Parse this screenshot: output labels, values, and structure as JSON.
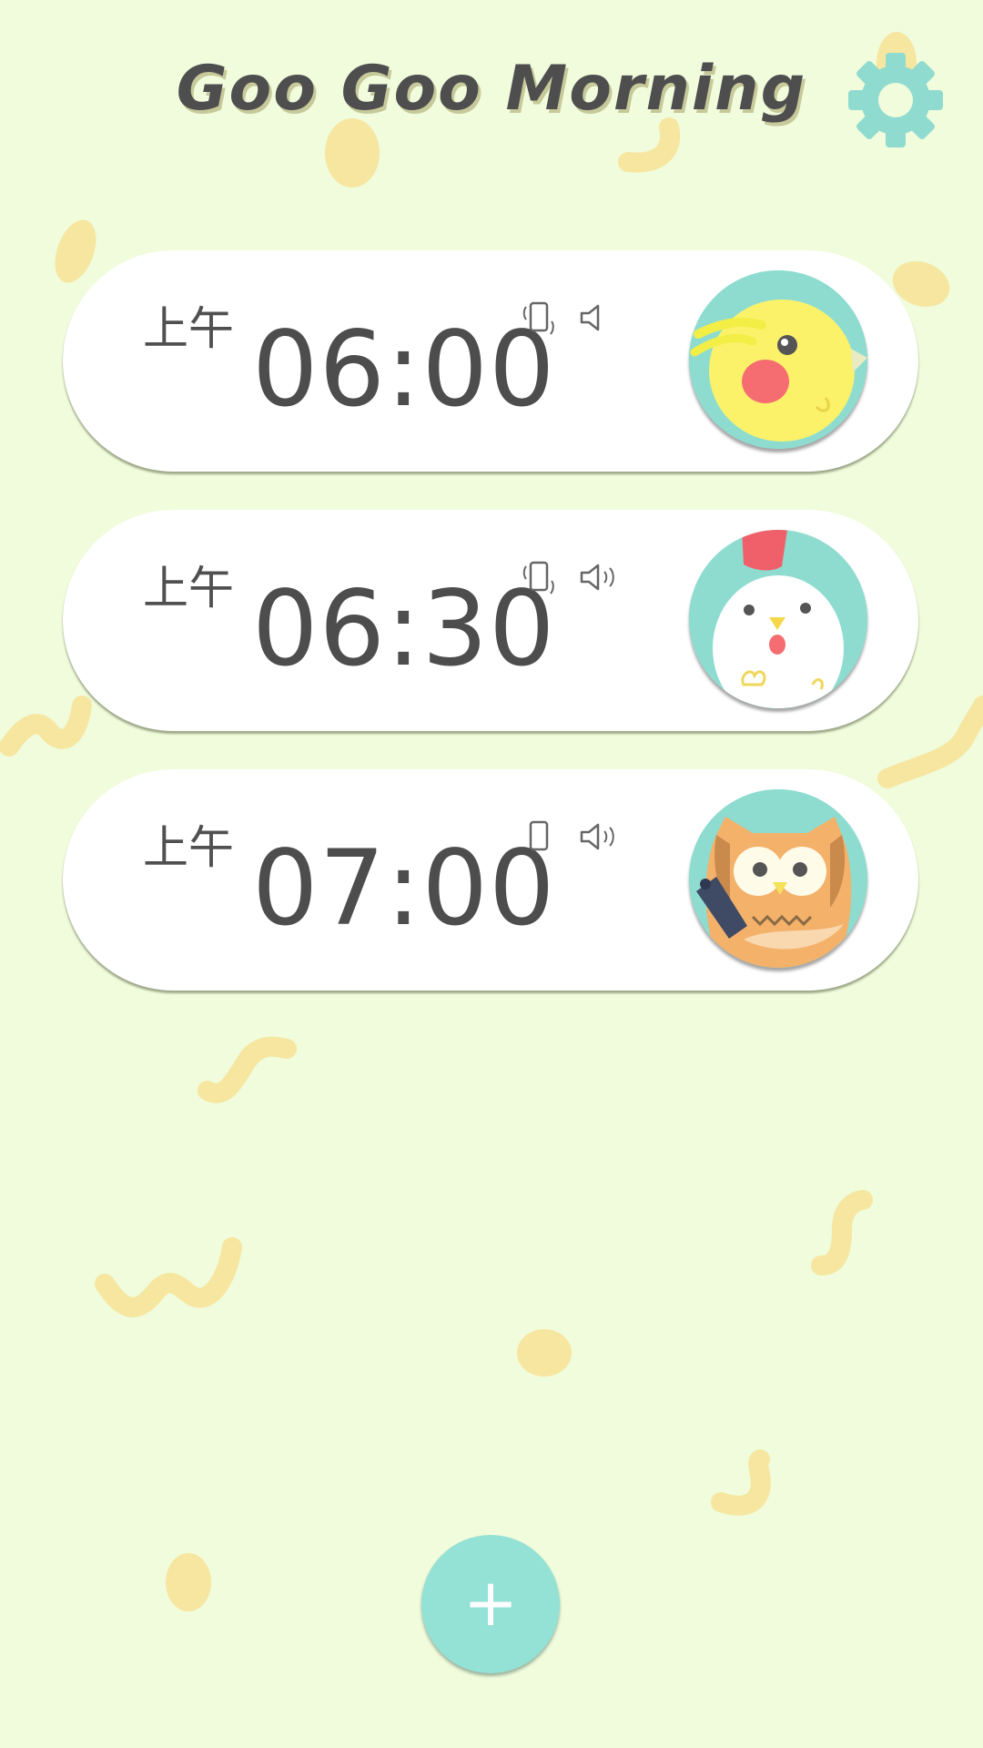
{
  "app": {
    "title": "Goo Goo Morning"
  },
  "settings": {
    "icon": "gear-icon"
  },
  "alarms": [
    {
      "period": "上午",
      "time": "06:00",
      "vibrate_icon": "vibrate-icon",
      "sound_icon": "speaker-muted-icon",
      "avatar": "cockatiel-bird-avatar"
    },
    {
      "period": "上午",
      "time": "06:30",
      "vibrate_icon": "vibrate-icon",
      "sound_icon": "speaker-on-icon",
      "avatar": "rooster-avatar"
    },
    {
      "period": "上午",
      "time": "07:00",
      "vibrate_icon": "phone-icon",
      "sound_icon": "speaker-on-icon",
      "avatar": "owl-avatar"
    }
  ],
  "add_button": {
    "label": "+",
    "icon": "plus-icon"
  },
  "colors": {
    "background": "#f0fcdc",
    "accent": "#94e1d5",
    "card": "#ffffff",
    "text": "#4d4d4d",
    "decoration": "#f7e7a0"
  }
}
